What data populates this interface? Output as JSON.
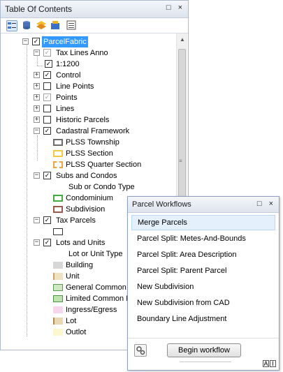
{
  "toc": {
    "title": "Table Of Contents",
    "pin_glyph": "□",
    "close_glyph": "×",
    "toolbar_icons": [
      "list-by-drawing-order-icon",
      "list-by-source-icon",
      "list-by-visibility-icon",
      "list-by-selection-icon",
      "options-icon"
    ]
  },
  "tree": {
    "parcel_fabric": "ParcelFabric",
    "tax_lines_anno": "Tax Lines Anno",
    "scale": "1:1200",
    "control": "Control",
    "line_points": "Line Points",
    "points": "Points",
    "lines": "Lines",
    "historic_parcels": "Historic Parcels",
    "cadastral_framework": "Cadastral Framework",
    "plss_township": "PLSS Township",
    "plss_section": "PLSS Section",
    "plss_quarter_section": "PLSS Quarter Section",
    "subs_and_condos": "Subs and Condos",
    "sub_or_condo_type": "Sub or Condo Type",
    "condominium": "Condominium",
    "subdivision": "Subdivision",
    "tax_parcels": "Tax Parcels",
    "lots_and_units": "Lots and Units",
    "lot_or_unit_type": "Lot or Unit Type",
    "building": "Building",
    "unit": "Unit",
    "general_common": "General Common E",
    "limited_common": "Limited Common E",
    "ingress_egress": "Ingress/Egress",
    "lot": "Lot",
    "outlot": "Outlot"
  },
  "workflows": {
    "title": "Parcel Workflows",
    "pin_glyph": "□",
    "close_glyph": "×",
    "items": [
      "Merge Parcels",
      "Parcel Split: Metes-And-Bounds",
      "Parcel Split: Area Description",
      "Parcel Split: Parent Parcel",
      "New Subdivision",
      "New Subdivision from CAD",
      "Boundary Line Adjustment"
    ],
    "selected_index": 0,
    "begin_button": "Begin workflow",
    "corner_glyphs": [
      "A",
      "I"
    ]
  },
  "colors": {
    "selection": "#3399ff",
    "plss_township": "#6b6b6b",
    "plss_section": "#f5c842",
    "plss_quarter_section": "#f0a540",
    "condominium": "#3fae3f",
    "subdivision": "#9a5a4a",
    "building": "#d7d7d7",
    "unit": "#f0e2c0",
    "general_common": "#cfe8c4",
    "limited_common": "#bfe3b0",
    "ingress_egress": "#f5d6ea",
    "lot": "#ead7b4",
    "outlot": "#fdf7d0"
  }
}
